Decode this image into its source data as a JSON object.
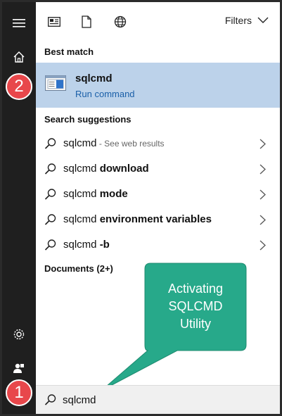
{
  "toolbar": {
    "filters_label": "Filters",
    "icons": [
      "apps-icon",
      "document-icon",
      "globe-icon",
      "chevron-down-icon"
    ]
  },
  "rail": {
    "icons": [
      "hamburger-menu-icon",
      "home-icon",
      "settings-icon",
      "user-icon"
    ]
  },
  "best_match": {
    "section_label": "Best match",
    "title": "sqlcmd",
    "subtitle": "Run command"
  },
  "suggestions": {
    "section_label": "Search suggestions",
    "items": [
      {
        "prefix": "sqlcmd",
        "bold": "",
        "hint": " - See web results"
      },
      {
        "prefix": "sqlcmd ",
        "bold": "download",
        "hint": ""
      },
      {
        "prefix": "sqlcmd ",
        "bold": "mode",
        "hint": ""
      },
      {
        "prefix": "sqlcmd ",
        "bold": "environment variables",
        "hint": ""
      },
      {
        "prefix": "sqlcmd ",
        "bold": "-b",
        "hint": ""
      }
    ]
  },
  "documents": {
    "section_label": "Documents (2+)"
  },
  "search": {
    "value": "sqlcmd"
  },
  "annotations": {
    "badge_1": "1",
    "badge_2": "2",
    "callout_line1": "Activating",
    "callout_line2": "SQLCMD",
    "callout_line3": "Utility"
  },
  "colors": {
    "rail": "#1f1f1f",
    "highlight": "#bcd2ea",
    "link": "#1a5fa8",
    "badge": "#e8474b",
    "callout": "#27a98a"
  }
}
